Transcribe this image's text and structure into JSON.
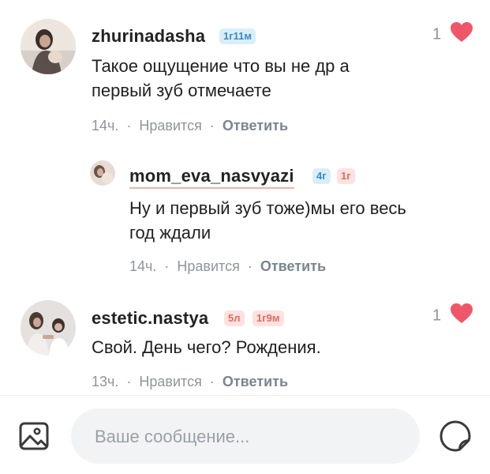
{
  "comments": [
    {
      "username": "zhurinadasha",
      "badges": [
        "1г11м"
      ],
      "text_lines": [
        "Такое ощущение что вы  не др а",
        "первый зуб отмечаете"
      ],
      "time": "14ч.",
      "like_label": "Нравится",
      "reply_label": "Ответить",
      "likes": "1"
    },
    {
      "username": "mom_eva_nasvyazi",
      "badges": [
        "4г",
        "1г"
      ],
      "text_lines": [
        "Ну и первый зуб тоже)мы его весь",
        "год ждали"
      ],
      "time": "14ч.",
      "like_label": "Нравится",
      "reply_label": "Ответить"
    },
    {
      "username": "estetic.nastya",
      "badges": [
        "5л",
        "1г9м"
      ],
      "text_lines": [
        "Свой. День чего? Рождения."
      ],
      "time": "13ч.",
      "like_label": "Нравится",
      "reply_label": "Ответить",
      "likes": "1"
    }
  ],
  "composer": {
    "placeholder": "Ваше сообщение...",
    "value": ""
  },
  "icons": {
    "heart": "heart-icon",
    "gallery": "image-gallery-icon",
    "sticker": "sticker-icon"
  },
  "colors": {
    "heart": "#f0566a",
    "badge_age_bg": "#d9eefa",
    "badge_age_text": "#3a8ac4",
    "badge_child_bg": "#fde2e0",
    "badge_child_text": "#e06a5f",
    "meta": "#8e959c"
  }
}
